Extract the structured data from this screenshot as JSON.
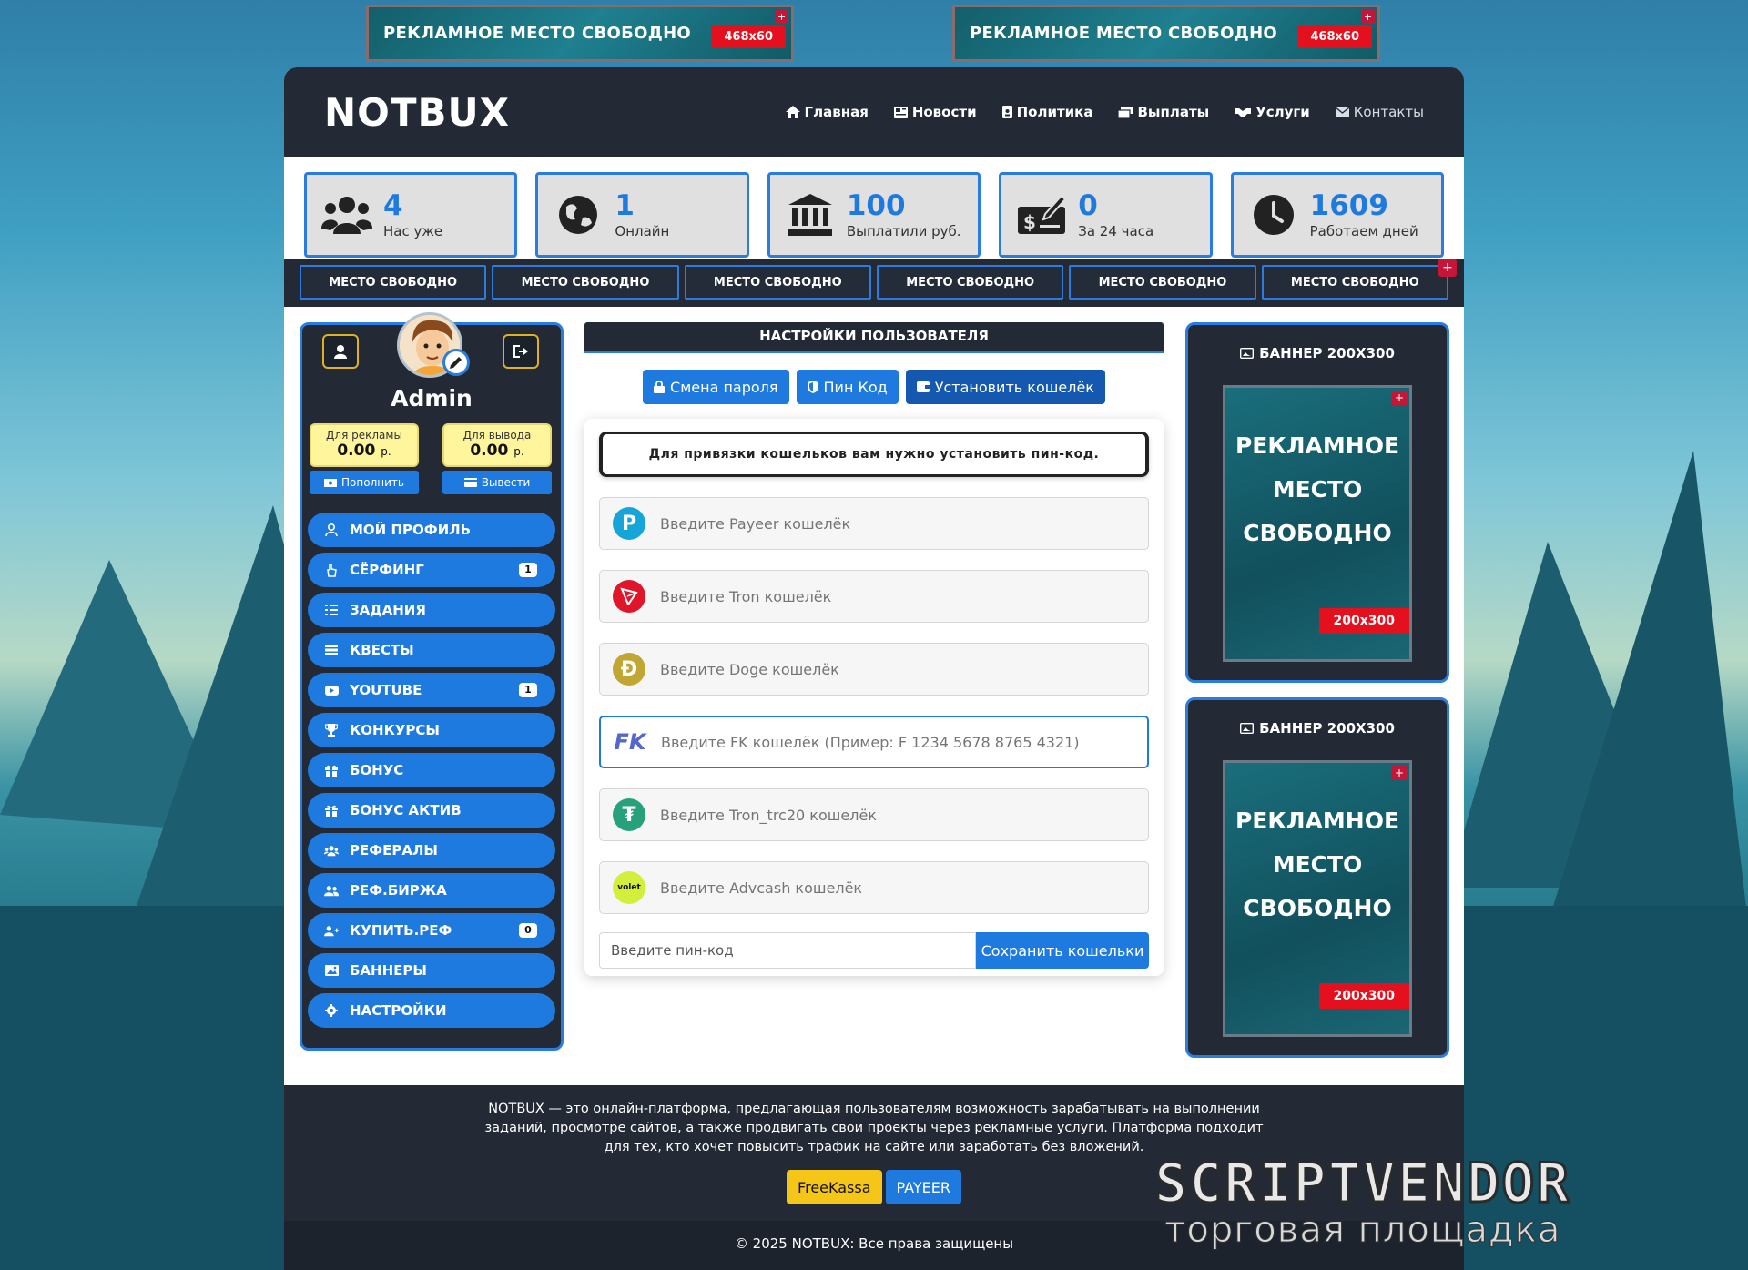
{
  "top_banners": [
    {
      "text": "РЕКЛАМНОЕ  МЕСТО СВОБОДНО",
      "size": "468x60"
    },
    {
      "text": "РЕКЛАМНОЕ  МЕСТО СВОБОДНО",
      "size": "468x60"
    }
  ],
  "header": {
    "logo": "NOTBUX",
    "nav": [
      {
        "label": "Главная",
        "icon": "home-icon"
      },
      {
        "label": "Новости",
        "icon": "newspaper-icon"
      },
      {
        "label": "Политика",
        "icon": "id-badge-icon"
      },
      {
        "label": "Выплаты",
        "icon": "money-icon"
      },
      {
        "label": "Услуги",
        "icon": "handshake-icon"
      },
      {
        "label": "Контакты",
        "icon": "envelope-icon"
      }
    ]
  },
  "stats": [
    {
      "value": "4",
      "label": "Нас уже",
      "icon": "users-icon"
    },
    {
      "value": "1",
      "label": "Онлайн",
      "icon": "globe-icon"
    },
    {
      "value": "100",
      "label": "Выплатили руб.",
      "icon": "bank-icon"
    },
    {
      "value": "0",
      "label": "За 24 часа",
      "icon": "check-money-icon"
    },
    {
      "value": "1609",
      "label": "Работаем дней",
      "icon": "clock-icon"
    }
  ],
  "ad_slots": [
    "МЕСТО СВОБОДНО",
    "МЕСТО СВОБОДНО",
    "МЕСТО СВОБОДНО",
    "МЕСТО СВОБОДНО",
    "МЕСТО СВОБОДНО",
    "МЕСТО СВОБОДНО"
  ],
  "user": {
    "name": "Admin",
    "balance_ads_label": "Для рекламы",
    "balance_ads_value": "0.00",
    "balance_withdraw_label": "Для вывода",
    "balance_withdraw_value": "0.00",
    "currency": "р.",
    "topup_label": "Пополнить",
    "withdraw_label": "Вывести"
  },
  "menu": [
    {
      "label": "МОЙ ПРОФИЛЬ",
      "icon": "user-icon",
      "badge": ""
    },
    {
      "label": "СЁРФИНГ",
      "icon": "hand-pointer-icon",
      "badge": "1"
    },
    {
      "label": "ЗАДАНИЯ",
      "icon": "list-icon",
      "badge": ""
    },
    {
      "label": "КВЕСТЫ",
      "icon": "tasks-icon",
      "badge": ""
    },
    {
      "label": "YOUTUBE",
      "icon": "youtube-icon",
      "badge": "1"
    },
    {
      "label": "КОНКУРСЫ",
      "icon": "trophy-icon",
      "badge": ""
    },
    {
      "label": "БОНУС",
      "icon": "gift-icon",
      "badge": ""
    },
    {
      "label": "БОНУС АКТИВ",
      "icon": "gift-icon",
      "badge": ""
    },
    {
      "label": "РЕФЕРАЛЫ",
      "icon": "users-icon",
      "badge": ""
    },
    {
      "label": "РЕФ.БИРЖА",
      "icon": "user-group-icon",
      "badge": ""
    },
    {
      "label": "КУПИТЬ.РЕФ",
      "icon": "user-plus-icon",
      "badge": "0"
    },
    {
      "label": "БАННЕРЫ",
      "icon": "image-icon",
      "badge": ""
    },
    {
      "label": "НАСТРОЙКИ",
      "icon": "gear-icon",
      "badge": ""
    }
  ],
  "settings": {
    "title": "НАСТРОЙКИ ПОЛЬЗОВАТЕЛЯ",
    "tabs": [
      {
        "label": "Смена пароля",
        "icon": "lock-icon"
      },
      {
        "label": "Пин Код",
        "icon": "shield-icon"
      },
      {
        "label": "Установить кошелёк",
        "icon": "wallet-icon"
      }
    ],
    "warning": "Для привязки кошельков вам нужно установить пин-код.",
    "wallets": [
      {
        "placeholder": "Введите Payeer кошелёк",
        "icon": "payeer-icon",
        "glyph": "P",
        "color": "#16a5d8"
      },
      {
        "placeholder": "Введите Tron кошелёк",
        "icon": "tron-icon",
        "glyph": "",
        "color": "#e0152a"
      },
      {
        "placeholder": "Введите Doge кошелёк",
        "icon": "doge-icon",
        "glyph": "Ð",
        "color": "#c2a633"
      },
      {
        "placeholder": "Введите FK кошелёк (Пример: F 1234 5678 8765 4321)",
        "icon": "fk-icon",
        "glyph": "FK",
        "color": "#ffffff"
      },
      {
        "placeholder": "Введите Tron_trc20 кошелёк",
        "icon": "tether-icon",
        "glyph": "₮",
        "color": "#26a17b"
      },
      {
        "placeholder": "Введите Advcash кошелёк",
        "icon": "volet-icon",
        "glyph": "volet",
        "color": "#d4ee3c"
      }
    ],
    "pin_placeholder": "Введите пин-код",
    "save_label": "Сохранить кошельки"
  },
  "right_banners": [
    {
      "title": "БАННЕР 200Х300",
      "text_lines": [
        "РЕКЛАМНОЕ",
        "МЕСТО",
        "СВОБОДНО"
      ],
      "size": "200x300"
    },
    {
      "title": "БАННЕР 200Х300",
      "text_lines": [
        "РЕКЛАМНОЕ",
        "МЕСТО",
        "СВОБОДНО"
      ],
      "size": "200x300"
    }
  ],
  "footer": {
    "text": "NOTBUX — это онлайн-платформа, предлагающая пользователям возможность зарабатывать на выполнении заданий, просмотре сайтов, а также продвигать свои проекты через рекламные услуги. Платформа подходит для тех, кто хочет повысить трафик на сайте или заработать без вложений.",
    "buttons": [
      {
        "label": "FreeKassa",
        "color": "#f5c518"
      },
      {
        "label": "PAYEER",
        "color": "#1f7ae0"
      }
    ],
    "copyright": "© 2025 NOTBUX: Все права защищены"
  },
  "watermark": {
    "line1": "SCRIPTVENDOR",
    "line2": "торговая площадка"
  },
  "colors": {
    "accent": "#1f7ae0",
    "dark": "#232a36",
    "ad_red": "#e5101d"
  }
}
